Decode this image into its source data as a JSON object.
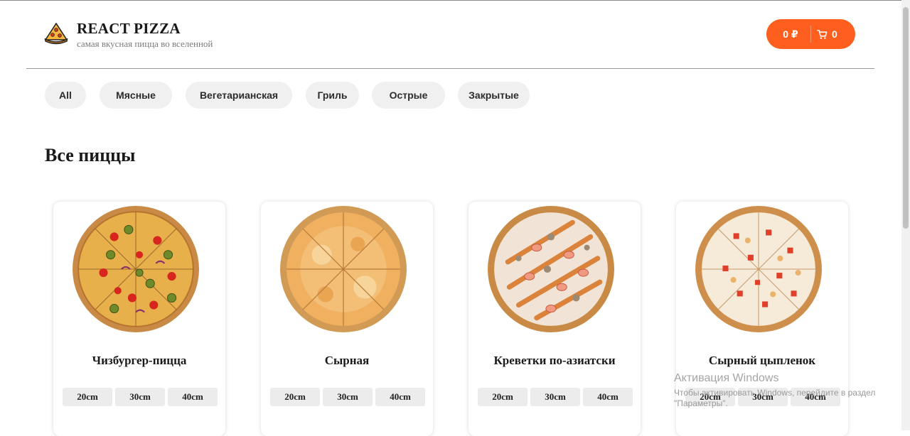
{
  "header": {
    "title": "REACT PIZZA",
    "subtitle": "самая вкусная пицца во вселенной",
    "cart": {
      "price": "0 ₽",
      "count": "0"
    }
  },
  "categories": [
    "All",
    "Мясные",
    "Вегетарианская",
    "Гриль",
    "Острые",
    "Закрытые"
  ],
  "section_title": "Все пиццы",
  "pizzas": [
    {
      "name": "Чизбургер-пицца",
      "sizes": [
        "20cm",
        "30cm",
        "40cm"
      ]
    },
    {
      "name": "Сырная",
      "sizes": [
        "20cm",
        "30cm",
        "40cm"
      ]
    },
    {
      "name": "Креветки по-азиатски",
      "sizes": [
        "20cm",
        "30cm",
        "40cm"
      ]
    },
    {
      "name": "Сырный цыпленок",
      "sizes": [
        "20cm",
        "30cm",
        "40cm"
      ]
    }
  ],
  "watermark": {
    "title": "Активация Windows",
    "text": "Чтобы активировать Windows, перейдите в раздел \"Параметры\"."
  },
  "colors": {
    "accent": "#fe5f1e",
    "pill_bg": "#f0f0f0"
  }
}
